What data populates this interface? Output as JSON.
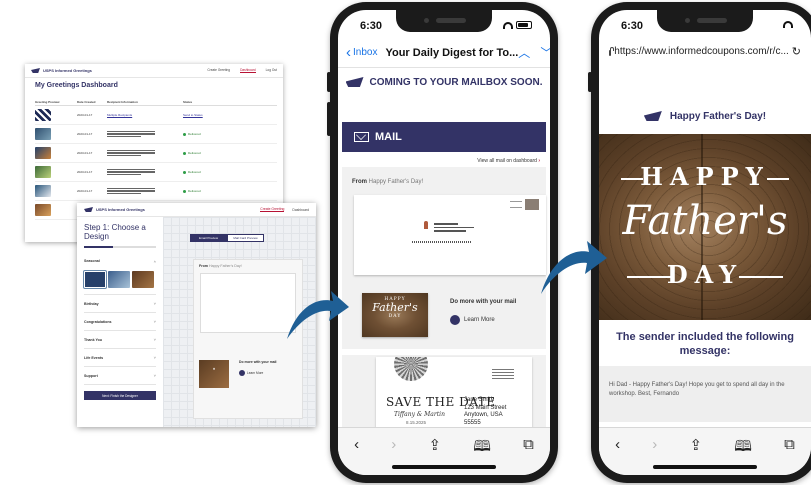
{
  "dashboard": {
    "brand": "USPS Informed Greetings",
    "nav": [
      "Create Greeting",
      "Dashboard",
      "Log Out"
    ],
    "title": "My Greetings Dashboard",
    "columns": [
      "Greeting Preview",
      "Date Created",
      "Recipient Information",
      "Status"
    ],
    "rows": [
      {
        "date": "2023-01-17",
        "recipient": "Multiple Recipients",
        "status": "Send to Status"
      },
      {
        "date": "2023-01-17",
        "recipient": "",
        "status": "Delivered"
      },
      {
        "date": "2023-01-17",
        "recipient": "",
        "status": "Delivered"
      },
      {
        "date": "2023-01-17",
        "recipient": "",
        "status": "Delivered"
      },
      {
        "date": "2023-01-17",
        "recipient": "",
        "status": "Delivered"
      },
      {
        "date": "2023-01-17",
        "recipient": "",
        "status": ""
      }
    ]
  },
  "designer": {
    "brand": "USPS Informed Greetings",
    "nav_create": "Create Greeting",
    "nav_dashboard": "Dashboard",
    "step_title": "Step 1: Choose a Design",
    "categories": [
      "Seasonal",
      "Birthday",
      "Congratulations",
      "Thank You",
      "Life Events",
      "Support"
    ],
    "next_button": "Next: Finish the Designer",
    "tab_email": "Email Preview",
    "tab_mail": "Mail Card Preview",
    "from_label": "From",
    "from_value": "Happy Father's Day!",
    "more_label": "Do more with your mail",
    "learn_label": "Learn More"
  },
  "phone_email": {
    "time": "6:30",
    "back_label": "Inbox",
    "subject": "Your Daily Digest for To...",
    "coming_soon": "COMING TO YOUR MAILBOX SOON.",
    "mail_label": "MAIL",
    "view_all": "View all mail on dashboard",
    "from_label": "From",
    "from_value": "Happy Father's Day!",
    "card_line1": "HAPPY",
    "card_line2": "Father's",
    "card_line3": "DAY",
    "more_label": "Do more with your mail",
    "learn_label": "Learn More",
    "save_title": "SAVE THE DATE",
    "save_names": "Tiffany & Martin",
    "save_date": "8.15.2025",
    "save_address": [
      "Jane Smith",
      "123 Main Street",
      "Anytown, USA",
      "55555"
    ]
  },
  "phone_web": {
    "time": "6:30",
    "url": "https://www.informedcoupons.com/r/c...",
    "header": "Happy Father's Day!",
    "hero_line1": "HAPPY",
    "hero_line2": "Father's",
    "hero_line3": "DAY",
    "sender_text": "The sender included the following message:",
    "message": "Hi Dad - Happy Father's Day! Hope you get to spend all day in the workshop. Best, Fernando"
  },
  "colors": {
    "usps_blue": "#333366",
    "usps_red": "#b71234",
    "arrow_blue": "#1f5f95",
    "ios_blue": "#1a74e6"
  }
}
